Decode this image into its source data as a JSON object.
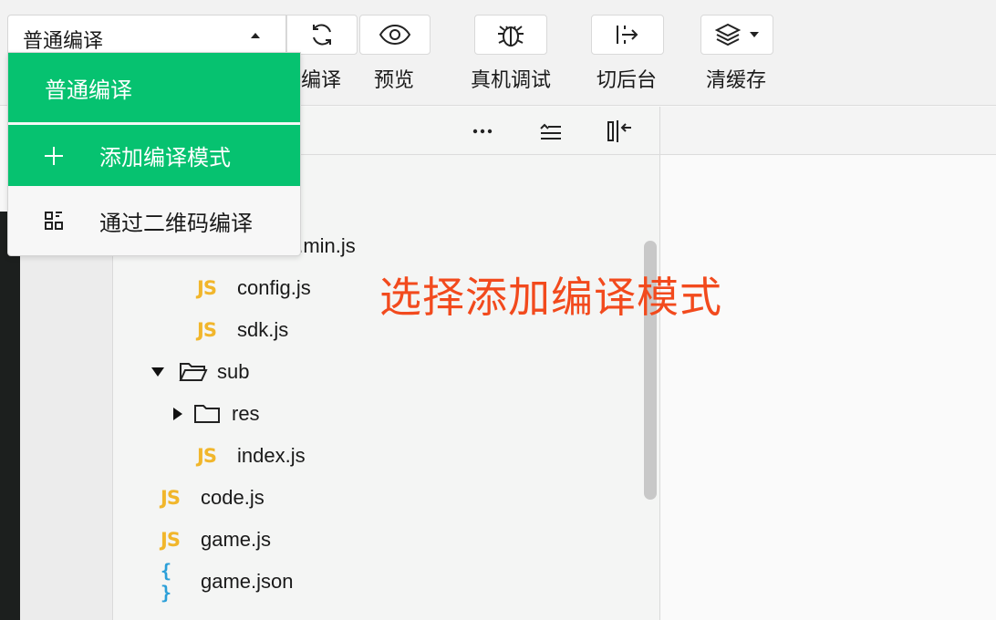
{
  "toolbar": {
    "mode_select": {
      "value": "普通编译"
    },
    "buttons": [
      {
        "id": "compile",
        "label": "编译",
        "icon": "refresh-icon"
      },
      {
        "id": "preview",
        "label": "预览",
        "icon": "eye-icon"
      },
      {
        "id": "remote_debug",
        "label": "真机调试",
        "icon": "bug-icon"
      },
      {
        "id": "background",
        "label": "切后台",
        "icon": "switch-background-icon"
      },
      {
        "id": "clear_cache",
        "label": "清缓存",
        "icon": "layers-icon"
      }
    ]
  },
  "dropdown": {
    "items": [
      {
        "label": "普通编译",
        "selected": true
      },
      {
        "label": "添加编译模式",
        "icon": "plus-icon",
        "highlighted": true
      },
      {
        "label": "通过二维码编译",
        "icon": "qrcode-icon"
      }
    ]
  },
  "file_tree": {
    "items": [
      {
        "name": "e.min.js",
        "type": "js"
      },
      {
        "name": "config.js",
        "type": "js"
      },
      {
        "name": "sdk.js",
        "type": "js"
      },
      {
        "name": "sub",
        "type": "folder-open"
      },
      {
        "name": "res",
        "type": "folder-closed"
      },
      {
        "name": "index.js",
        "type": "js"
      },
      {
        "name": "code.js",
        "type": "js"
      },
      {
        "name": "game.js",
        "type": "js"
      },
      {
        "name": "game.json",
        "type": "json"
      }
    ],
    "js_badge": "JS",
    "json_badge": "{ }"
  },
  "annotation": "选择添加编译模式",
  "colors": {
    "accent_green": "#06c270",
    "annotation_red": "#f24a1d",
    "js_yellow": "#f1b62b",
    "json_blue": "#2a9fd8"
  }
}
